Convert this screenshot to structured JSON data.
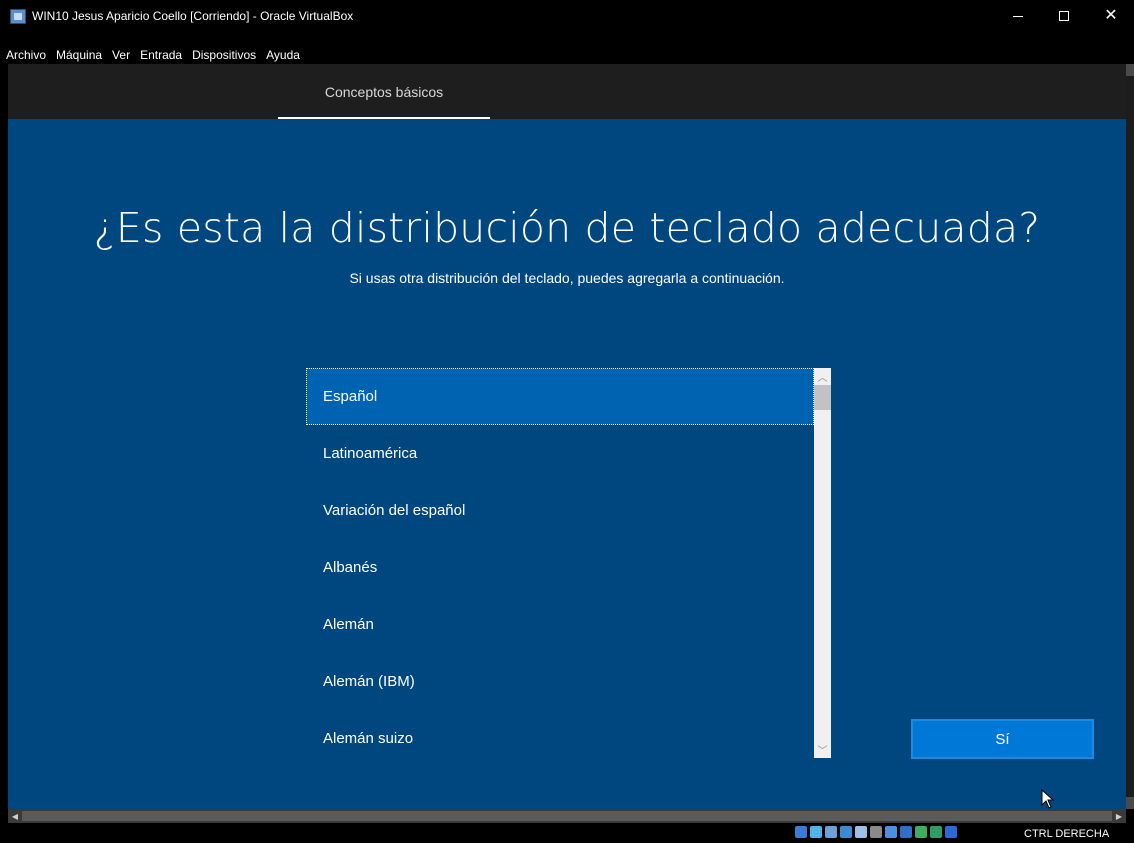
{
  "window": {
    "title": "WIN10 Jesus Aparicio Coello [Corriendo] - Oracle VirtualBox",
    "minimize_glyph": "—",
    "maximize_glyph": "☐",
    "close_glyph": "✕"
  },
  "menu": [
    "Archivo",
    "Máquina",
    "Ver",
    "Entrada",
    "Dispositivos",
    "Ayuda"
  ],
  "guest": {
    "header_tab": "Conceptos básicos",
    "question": "¿Es esta la distribución de teclado adecuada?",
    "subtitle": "Si usas otra distribución del teclado, puedes agregarla a continuación.",
    "options": [
      {
        "label": "Español",
        "selected": true
      },
      {
        "label": "Latinoamérica",
        "selected": false
      },
      {
        "label": "Variación del español",
        "selected": false
      },
      {
        "label": "Albanés",
        "selected": false
      },
      {
        "label": "Alemán",
        "selected": false
      },
      {
        "label": "Alemán (IBM)",
        "selected": false
      },
      {
        "label": "Alemán suizo",
        "selected": false
      }
    ],
    "yes_button": "Sí"
  },
  "statusbar": {
    "host_key": "CTRL DERECHA",
    "icons": [
      {
        "name": "hard-disk-icon",
        "color": "#3b7bd8"
      },
      {
        "name": "optical-drive-icon",
        "color": "#4fb3e8"
      },
      {
        "name": "audio-icon",
        "color": "#6f9fd8"
      },
      {
        "name": "network-icon",
        "color": "#3a8ad6"
      },
      {
        "name": "usb-icon",
        "color": "#9ec0e8"
      },
      {
        "name": "shared-folders-icon",
        "color": "#8a8a8a"
      },
      {
        "name": "display-icon",
        "color": "#4d8ee0"
      },
      {
        "name": "video-capture-icon",
        "color": "#2f6fc9"
      },
      {
        "name": "mouse-integration-icon",
        "color": "#3fae5c"
      },
      {
        "name": "cpu-icon",
        "color": "#2e9e63"
      },
      {
        "name": "keyboard-icon",
        "color": "#2b6ad6"
      }
    ]
  }
}
